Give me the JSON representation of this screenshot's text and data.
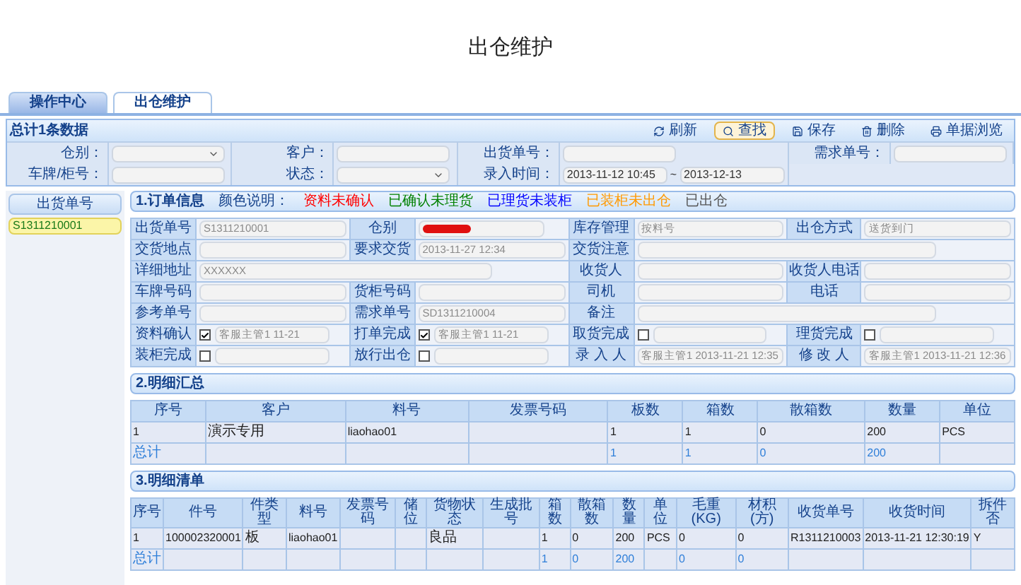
{
  "title": "出仓维护",
  "tabs": [
    {
      "label": "操作中心",
      "selected": false
    },
    {
      "label": "出仓维护",
      "selected": true
    }
  ],
  "toolbar": {
    "summary": "总计1条数据",
    "buttons": [
      {
        "label": "刷新",
        "kind": "refresh",
        "highlighted": false
      },
      {
        "label": "查找",
        "kind": "search",
        "highlighted": true
      },
      {
        "label": "保存",
        "kind": "save",
        "highlighted": false
      },
      {
        "label": "删除",
        "kind": "delete",
        "highlighted": false
      },
      {
        "label": "单据浏览",
        "kind": "print",
        "highlighted": false
      }
    ]
  },
  "search_form": {
    "rows": [
      [
        {
          "label": "仓别：",
          "kind": "select"
        },
        {
          "label": "客户：",
          "kind": "text"
        },
        {
          "label": "出货单号：",
          "kind": "text"
        },
        {
          "label": "需求单号：",
          "kind": "text"
        }
      ],
      [
        {
          "label": "车牌/柜号：",
          "kind": "text"
        },
        {
          "label": "状态：",
          "kind": "select"
        },
        {
          "label": "录入时间：",
          "kind": "range",
          "from": "2013-11-12 10:45",
          "separator": "~",
          "to": "2013-12-13"
        }
      ]
    ]
  },
  "sidebar": {
    "header": "出货单号",
    "items": [
      {
        "label": "S1311210001",
        "selected": true
      }
    ]
  },
  "order_info": {
    "title": "1.订单信息",
    "legend_label": "颜色说明：",
    "legend": [
      {
        "label": "资料未确认",
        "color": "#ff0000"
      },
      {
        "label": "已确认未理货",
        "color": "#008000"
      },
      {
        "label": "已理货未装柜",
        "color": "#0000ff"
      },
      {
        "label": "已装柜未出仓",
        "color": "#ff9900"
      },
      {
        "label": "已出仓",
        "color": "#555555"
      }
    ],
    "rows": [
      [
        {
          "label": "出货单号",
          "kind": "text",
          "value": "S1311210001"
        },
        {
          "label": "仓别",
          "kind": "redacted"
        },
        {
          "label": "库存管理",
          "kind": "text",
          "value": "按料号"
        },
        {
          "label": "出仓方式",
          "kind": "text",
          "value": "送货到门"
        }
      ],
      [
        {
          "label": "交货地点",
          "kind": "text"
        },
        {
          "label": "要求交货",
          "kind": "text",
          "value": "2013-11-27 12:34"
        },
        {
          "label": "交货注意",
          "kind": "text",
          "wide": true
        }
      ],
      [
        {
          "label": "详细地址",
          "kind": "text",
          "value": "XXXXXX",
          "wide": true
        },
        "",
        {
          "label": "收货人",
          "kind": "text"
        },
        {
          "label": "收货人电话",
          "kind": "text"
        }
      ],
      [
        {
          "label": "车牌号码",
          "kind": "text"
        },
        {
          "label": "货柜号码",
          "kind": "text"
        },
        {
          "label": "司机",
          "kind": "text"
        },
        {
          "label": "电话",
          "kind": "text"
        }
      ],
      [
        {
          "label": "参考单号",
          "kind": "text"
        },
        {
          "label": "需求单号",
          "kind": "text",
          "value": "SD1311210004"
        },
        {
          "label": "备注",
          "kind": "text",
          "wide": true
        }
      ],
      [
        {
          "label": "资料确认",
          "kind": "check",
          "checked": true,
          "value": "客服主管1 11-21"
        },
        {
          "label": "打单完成",
          "kind": "check",
          "checked": true,
          "value": "客服主管1 11-21"
        },
        {
          "label": "取货完成",
          "kind": "check",
          "checked": false
        },
        {
          "label": "理货完成",
          "kind": "check",
          "checked": false
        }
      ],
      [
        {
          "label": "装柜完成",
          "kind": "check",
          "checked": false
        },
        {
          "label": "放行出仓",
          "kind": "check",
          "checked": false
        },
        {
          "label": "录 入 人",
          "kind": "text",
          "value": "客服主管1 2013-11-21 12:35"
        },
        {
          "label": "修 改 人",
          "kind": "text",
          "value": "客服主管1 2013-11-21 12:36"
        }
      ]
    ]
  },
  "summary": {
    "title": "2.明细汇总",
    "columns": [
      "序号",
      "客户",
      "料号",
      "发票号码",
      "板数",
      "箱数",
      "散箱数",
      "数量",
      "单位"
    ],
    "rows": [
      {
        "kind": "data",
        "cells": [
          "1",
          "演示专用",
          "liaohao01",
          null,
          "1",
          "1",
          "0",
          "200",
          "PCS"
        ]
      },
      {
        "kind": "total",
        "cells": [
          "总计",
          null,
          null,
          null,
          "1",
          "1",
          "0",
          "200",
          null
        ]
      }
    ]
  },
  "detail": {
    "title": "3.明细清单",
    "columns": [
      "序号",
      "件号",
      "件类型",
      "料号",
      "发票号码",
      "储位",
      "货物状态",
      "生成批号",
      "箱数",
      "散箱数",
      "数量",
      "单位",
      "毛重(KG)",
      "材积(方)",
      "收货单号",
      "收货时间",
      "拆件否"
    ],
    "rows": [
      {
        "kind": "data",
        "cells": [
          "1",
          "100002320001",
          "板",
          "liaohao01",
          null,
          null,
          "良品",
          null,
          "1",
          "0",
          "200",
          "PCS",
          "0",
          "0",
          "R1311210003",
          "2013-11-21 12:30:19",
          "Y"
        ]
      },
      {
        "kind": "total",
        "cells": [
          "总计",
          null,
          null,
          null,
          null,
          null,
          null,
          null,
          "1",
          "0",
          "200",
          null,
          "0",
          "0",
          null,
          null,
          null
        ]
      }
    ]
  }
}
